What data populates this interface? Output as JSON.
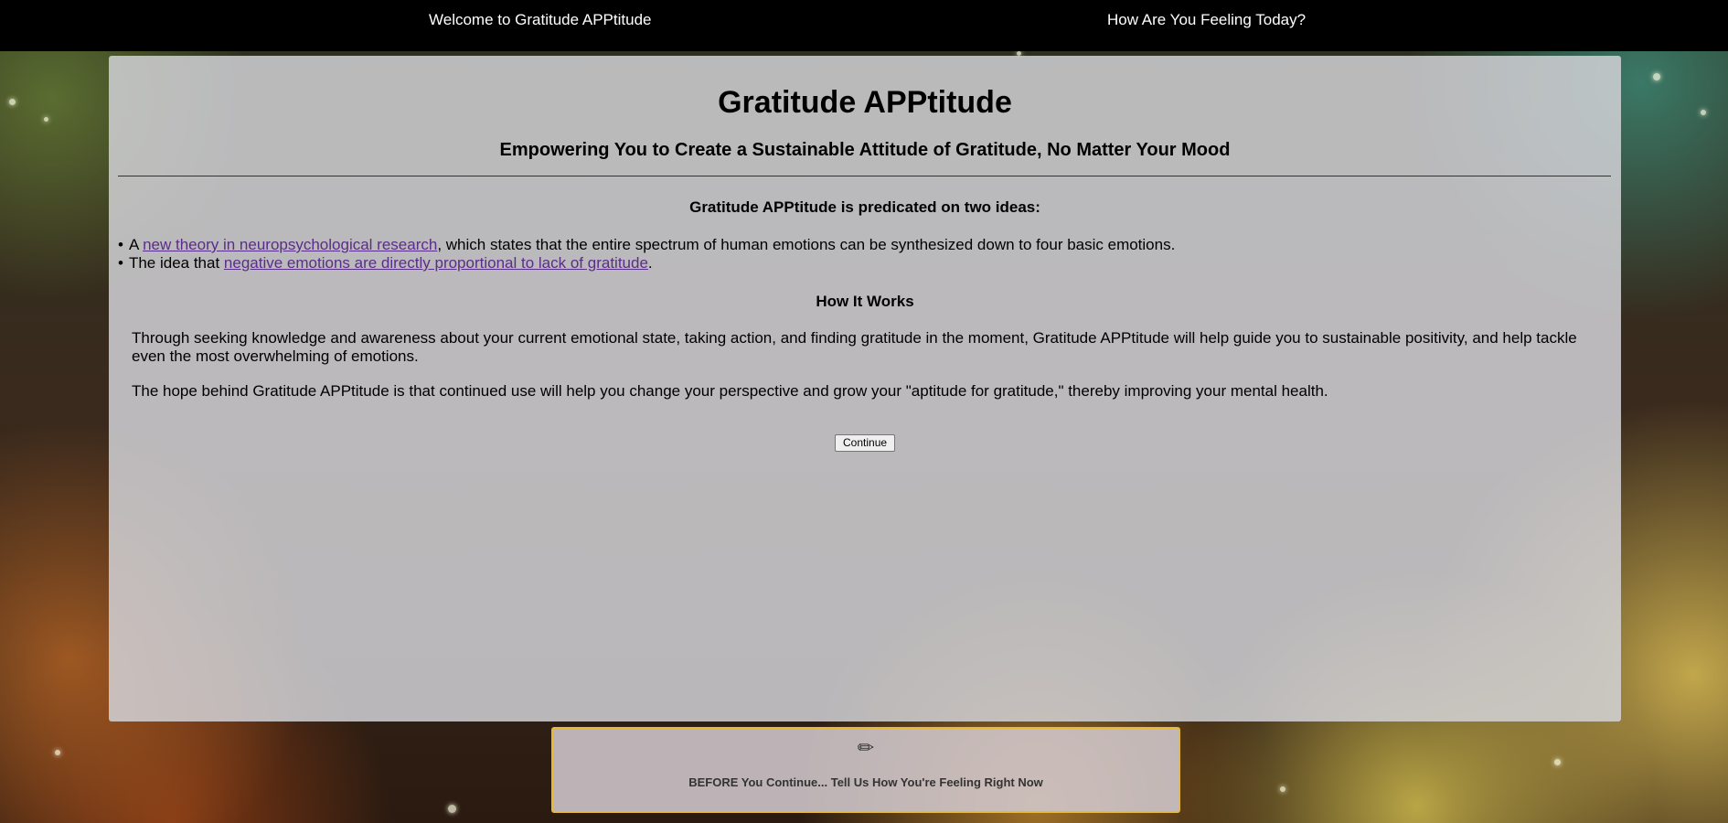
{
  "nav": {
    "welcome": "Welcome to Gratitude APPtitude",
    "feeling": "How Are You Feeling Today?"
  },
  "main": {
    "title": "Gratitude APPtitude",
    "subtitle": "Empowering You to Create a Sustainable Attitude of Gratitude, No Matter Your Mood",
    "predicated_heading": "Gratitude APPtitude is predicated on two ideas:",
    "ideas": [
      {
        "prefix": "A ",
        "link": "new theory in neuropsychological research",
        "suffix": ", which states that the entire spectrum of human emotions can be synthesized down to four basic emotions."
      },
      {
        "prefix": "The idea that ",
        "link": "negative emotions are directly proportional to lack of gratitude",
        "suffix": "."
      }
    ],
    "how_heading": "How It Works",
    "paragraph1": "Through seeking knowledge and awareness about your current emotional state, taking action, and finding gratitude in the moment, Gratitude APPtitude will help guide you to sustainable positivity, and help tackle even the most overwhelming of emotions.",
    "paragraph2": "The hope behind Gratitude APPtitude is that continued use will help you change your perspective and grow your \"aptitude for gratitude,\" thereby improving your mental health.",
    "continue_label": "Continue"
  },
  "feeling_box": {
    "icon": "pencil-icon",
    "icon_glyph": "✏",
    "text": "BEFORE You Continue... Tell Us How You're Feeling Right Now"
  },
  "colors": {
    "link": "#5a2d8a",
    "feeling_border": "#e6b93a",
    "topbar": "#000000"
  }
}
